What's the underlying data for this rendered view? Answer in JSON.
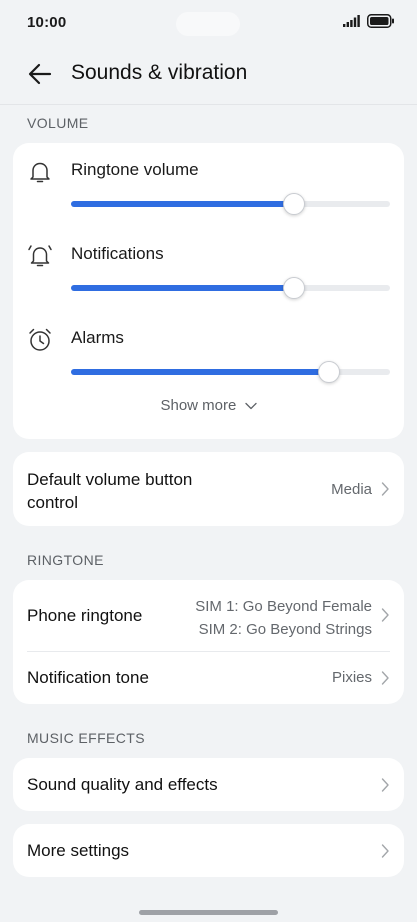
{
  "status_bar": {
    "time": "10:00"
  },
  "header": {
    "title": "Sounds & vibration"
  },
  "volume": {
    "section_label": "VOLUME",
    "items": [
      {
        "label": "Ringtone volume",
        "icon": "bell-icon",
        "level": 0.7
      },
      {
        "label": "Notifications",
        "icon": "notification-bell-icon",
        "level": 0.7
      },
      {
        "label": "Alarms",
        "icon": "alarm-clock-icon",
        "level": 0.81
      }
    ],
    "show_more": "Show more"
  },
  "default_volume": {
    "title_line1": "Default volume button",
    "title_line2": "control",
    "value": "Media"
  },
  "ringtone": {
    "section_label": "RINGTONE",
    "phone_ringtone": {
      "title": "Phone ringtone",
      "value_line1": "SIM 1: Go Beyond Female",
      "value_line2": "SIM 2: Go Beyond Strings"
    },
    "notification_tone": {
      "title": "Notification tone",
      "value": "Pixies"
    }
  },
  "music_effects": {
    "section_label": "MUSIC EFFECTS",
    "sound_quality": {
      "title": "Sound quality and effects"
    }
  },
  "more_settings": {
    "title": "More settings"
  },
  "colors": {
    "accent": "#2f6de1",
    "background": "#f1f3f5",
    "card": "#ffffff",
    "secondary_text": "#64686d"
  }
}
